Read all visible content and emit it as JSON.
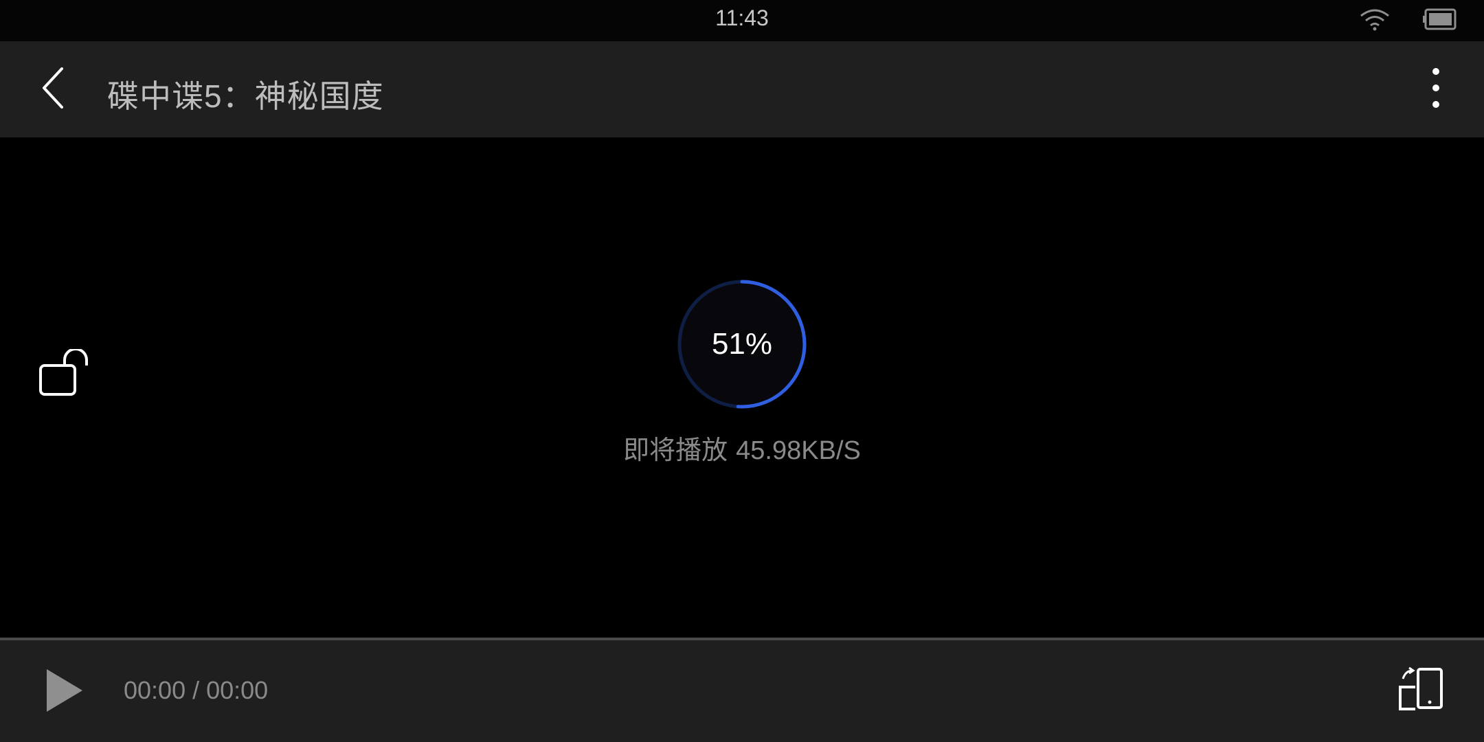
{
  "status_bar": {
    "time": "11:43",
    "icons": [
      "wifi-icon",
      "battery-icon"
    ]
  },
  "header": {
    "title": "碟中谍5：神秘国度",
    "icons": [
      "back-arrow-icon",
      "more-vertical-icon"
    ]
  },
  "player": {
    "loading_percent_label": "51%",
    "loading_progress": 0.51,
    "loading_message": "即将播放",
    "loading_speed": "45.98KB/S",
    "icons": [
      "unlock-icon"
    ]
  },
  "controls": {
    "current_time": "00:00",
    "separator": "/",
    "total_time": "00:00",
    "icons": [
      "play-icon",
      "screen-rotate-icon"
    ]
  },
  "colors": {
    "background": "#000000",
    "bar_background": "#1f1f1f",
    "accent": "#2f5fe0",
    "muted_text": "#8a8a8a"
  }
}
